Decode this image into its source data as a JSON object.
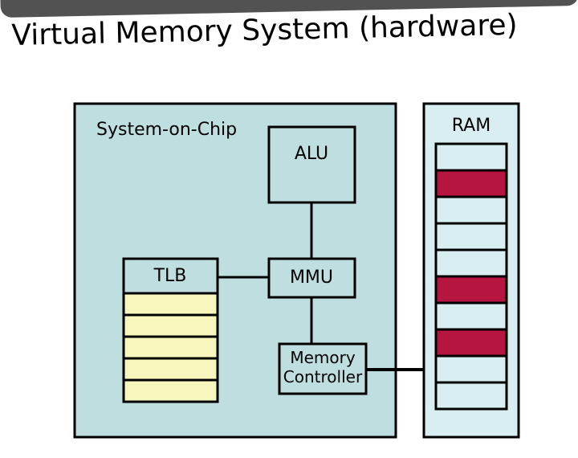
{
  "title": "Virtual Memory System (hardware)",
  "soc": {
    "label": "System-on-Chip"
  },
  "alu": {
    "label": "ALU"
  },
  "tlb": {
    "label": "TLB",
    "rows": 5
  },
  "mmu": {
    "label": "MMU"
  },
  "memctrl": {
    "label_line1": "Memory",
    "label_line2": "Controller"
  },
  "ram": {
    "label": "RAM",
    "row_colors": [
      "#d9eef0",
      "#b5153f",
      "#d9eef0",
      "#d9eef0",
      "#d9eef0",
      "#b5153f",
      "#d9eef0",
      "#b5153f",
      "#d9eef0",
      "#d9eef0"
    ]
  },
  "colors": {
    "soc_fill": "#bedee0",
    "box_fill": "#bedee0",
    "tlb_row_fill": "#f6f6bd",
    "stroke": "#000"
  }
}
